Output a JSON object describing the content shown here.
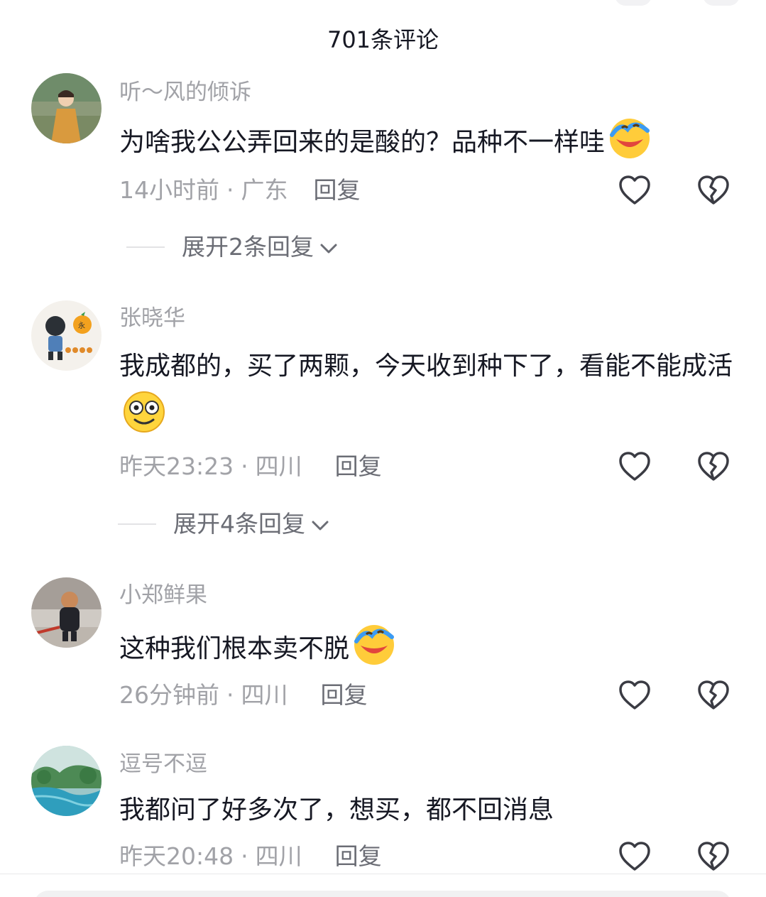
{
  "header": {
    "title": "701条评论"
  },
  "comments": [
    {
      "username": "听～风的倾诉",
      "text": "为啥我公公弄回来的是酸的？品种不一样哇",
      "emoji": "laugh-cry-emoji-icon",
      "time": "14小时前",
      "location": "广东",
      "reply_label": "回复",
      "expand_label": "展开2条回复"
    },
    {
      "username": "张晓华",
      "text": "我成都的，买了两颗，今天收到种下了，看能不能成活",
      "emoji": "smile-emoji-icon",
      "time": "昨天23:23",
      "location": "四川",
      "reply_label": "回复",
      "expand_label": "展开4条回复"
    },
    {
      "username": "小郑鲜果",
      "text": "这种我们根本卖不脱",
      "emoji": "laugh-cry-emoji-icon",
      "time": "26分钟前",
      "location": "四川",
      "reply_label": "回复"
    },
    {
      "username": "逗号不逗",
      "text": "我都问了好多次了，想买，都不回消息",
      "time": "昨天20:48",
      "location": "四川",
      "reply_label": "回复"
    }
  ],
  "meta_separator": "·",
  "colors": {
    "text": "#161823",
    "muted": "#a1a2a7",
    "action": "#6b6d75"
  }
}
